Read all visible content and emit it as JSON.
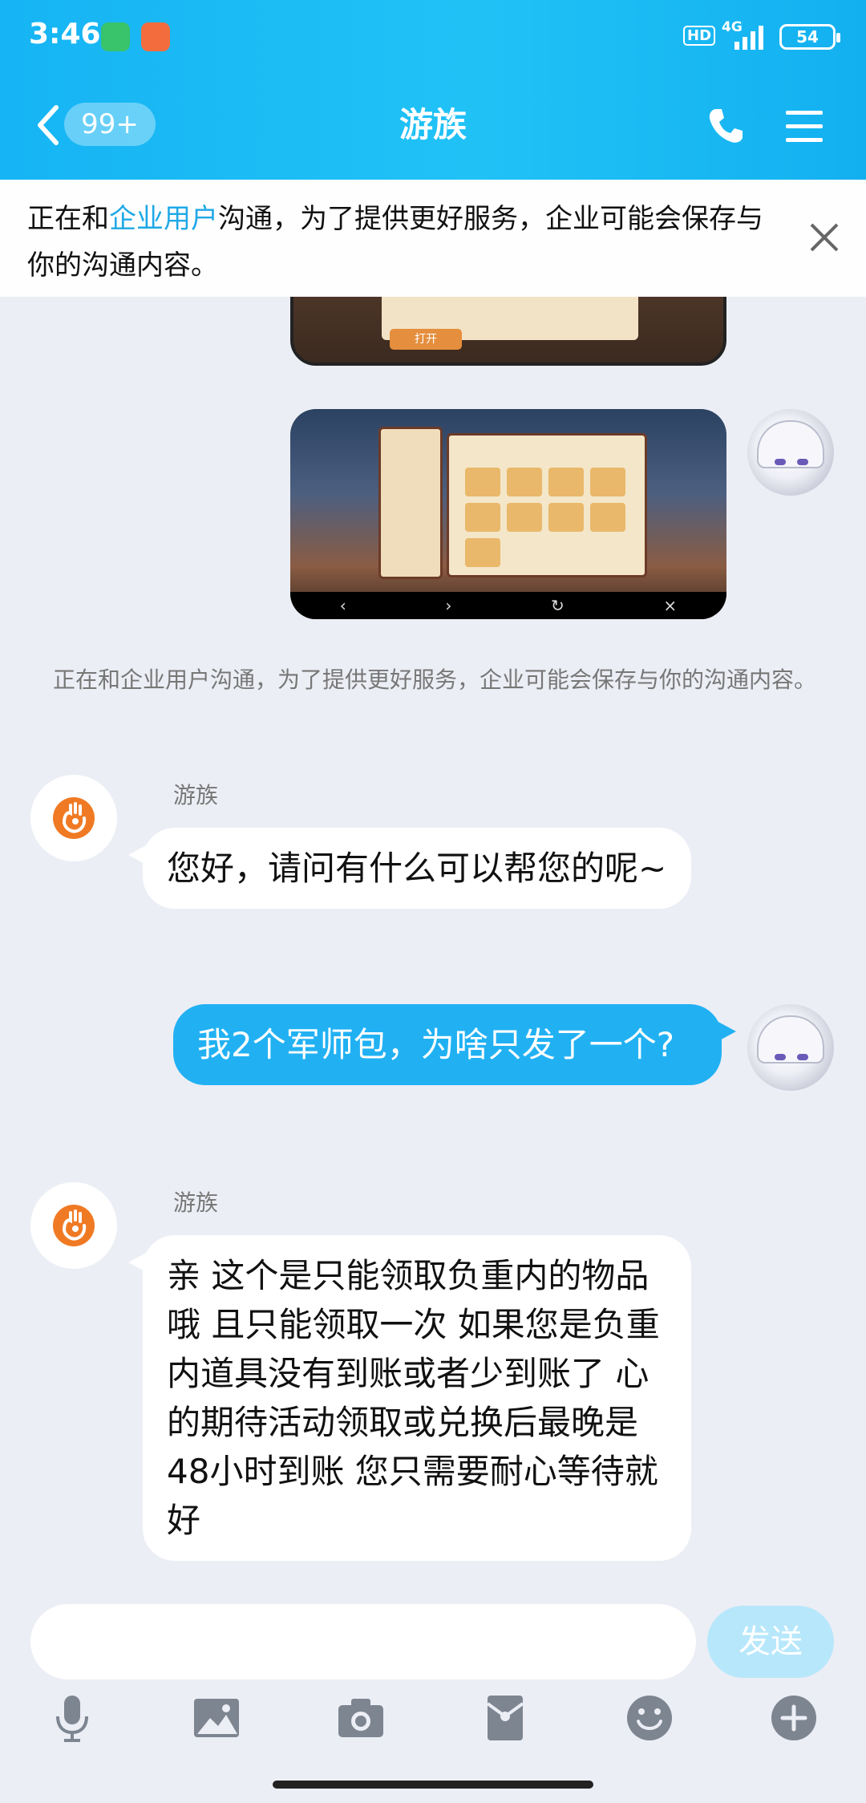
{
  "status_bar": {
    "time": "3:46",
    "hd": "HD",
    "network": "4G",
    "battery": "54"
  },
  "header": {
    "back_badge": "99+",
    "title": "游族"
  },
  "notice": {
    "prefix": "正在和",
    "highlight": "企业用户",
    "suffix": "沟通，为了提供更好服务，企业可能会保存与你的沟通内容。"
  },
  "screenshot": {
    "open_button": "打开"
  },
  "system_note": "正在和企业用户沟通，为了提供更好服务，企业可能会保存与你的沟通内容。",
  "messages": [
    {
      "sender": "游族",
      "text": "您好，请问有什么可以帮您的呢~"
    },
    {
      "sender": "",
      "text": "我2个军师包，为啥只发了一个?"
    },
    {
      "sender": "游族",
      "text": "亲 这个是只能领取负重内的物品哦 且只能领取一次 如果您是负重内道具没有到账或者少到账了  心的期待活动领取或兑换后最晚是48小时到账  您只需要耐心等待就好"
    }
  ],
  "input": {
    "value": "",
    "send_label": "发送"
  },
  "toolbar_icons": [
    "microphone-icon",
    "image-icon",
    "camera-icon",
    "red-packet-icon",
    "emoji-icon",
    "plus-icon"
  ],
  "colors": {
    "header": "#16b4f4",
    "bubble_self": "#21b1f3",
    "highlight": "#1fa8e6",
    "bot_logo": "#f07a24"
  }
}
